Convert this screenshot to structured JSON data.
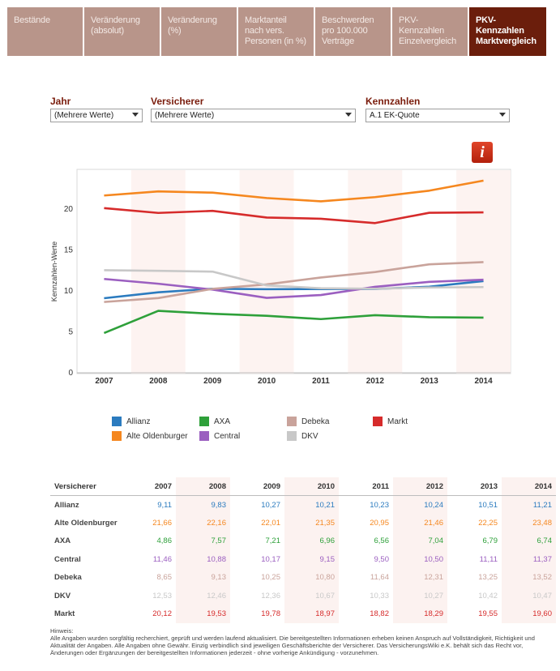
{
  "tabs": [
    {
      "label": "Bestände",
      "w": 93
    },
    {
      "label": "Veränderung (absolut)",
      "w": 93
    },
    {
      "label": "Veränderung (%)",
      "w": 93
    },
    {
      "label": "Marktanteil  nach vers. Personen (in %)",
      "w": 93
    },
    {
      "label": "Beschwerden pro 100.000 Verträge",
      "w": 93
    },
    {
      "label": "PKV-Kennzahlen Einzelvergleich",
      "w": 93
    },
    {
      "label": "PKV-Kennzahlen Marktvergleich",
      "w": 95,
      "active": true
    }
  ],
  "filters": {
    "year_label": "Jahr",
    "year_value": "(Mehrere Werte)",
    "insurer_label": "Versicherer",
    "insurer_value": "(Mehrere Werte)",
    "metric_label": "Kennzahlen",
    "metric_value": "A.1 EK-Quote"
  },
  "info_icon_glyph": "i",
  "chart_data": {
    "type": "line",
    "ylabel": "Kennzahlen-Werte",
    "xlabel": "",
    "categories": [
      "2007",
      "2008",
      "2009",
      "2010",
      "2011",
      "2012",
      "2013",
      "2014"
    ],
    "ylim": [
      0,
      25
    ],
    "yticks": [
      0,
      5,
      10,
      15,
      20
    ],
    "series": [
      {
        "name": "Allianz",
        "color": "#2b7bbf",
        "values": [
          9.11,
          9.83,
          10.27,
          10.21,
          10.23,
          10.24,
          10.51,
          11.21
        ]
      },
      {
        "name": "Alte Oldenburger",
        "color": "#f5871f",
        "values": [
          21.66,
          22.16,
          22.01,
          21.35,
          20.95,
          21.46,
          22.25,
          23.48
        ]
      },
      {
        "name": "AXA",
        "color": "#2ea03a",
        "values": [
          4.86,
          7.57,
          7.21,
          6.96,
          6.56,
          7.04,
          6.79,
          6.74
        ]
      },
      {
        "name": "Central",
        "color": "#9b5fc0",
        "values": [
          11.46,
          10.88,
          10.17,
          9.15,
          9.5,
          10.5,
          11.11,
          11.37
        ]
      },
      {
        "name": "Debeka",
        "color": "#c9a39b",
        "values": [
          8.65,
          9.13,
          10.25,
          10.8,
          11.64,
          12.31,
          13.25,
          13.52
        ]
      },
      {
        "name": "DKV",
        "color": "#c8c8c8",
        "values": [
          12.53,
          12.46,
          12.36,
          10.67,
          10.33,
          10.27,
          10.42,
          10.47
        ]
      },
      {
        "name": "Markt",
        "color": "#d62b2b",
        "values": [
          20.12,
          19.53,
          19.78,
          18.97,
          18.82,
          18.29,
          19.55,
          19.6
        ]
      }
    ]
  },
  "legend": [
    {
      "name": "Allianz",
      "color": "#2b7bbf"
    },
    {
      "name": "AXA",
      "color": "#2ea03a"
    },
    {
      "name": "Debeka",
      "color": "#c9a39b"
    },
    {
      "name": "Markt",
      "color": "#d62b2b"
    },
    {
      "name": "Alte Oldenburger",
      "color": "#f5871f"
    },
    {
      "name": "Central",
      "color": "#9b5fc0"
    },
    {
      "name": "DKV",
      "color": "#c8c8c8"
    }
  ],
  "table": {
    "header_name": "Versicherer",
    "years": [
      "2007",
      "2008",
      "2009",
      "2010",
      "2011",
      "2012",
      "2013",
      "2014"
    ],
    "rows": [
      {
        "name": "Allianz",
        "color": "#2b7bbf",
        "values": [
          "9,11",
          "9,83",
          "10,27",
          "10,21",
          "10,23",
          "10,24",
          "10,51",
          "11,21"
        ]
      },
      {
        "name": "Alte Oldenburger",
        "color": "#f5871f",
        "values": [
          "21,66",
          "22,16",
          "22,01",
          "21,35",
          "20,95",
          "21,46",
          "22,25",
          "23,48"
        ]
      },
      {
        "name": "AXA",
        "color": "#2ea03a",
        "values": [
          "4,86",
          "7,57",
          "7,21",
          "6,96",
          "6,56",
          "7,04",
          "6,79",
          "6,74"
        ]
      },
      {
        "name": "Central",
        "color": "#9b5fc0",
        "values": [
          "11,46",
          "10,88",
          "10,17",
          "9,15",
          "9,50",
          "10,50",
          "11,11",
          "11,37"
        ]
      },
      {
        "name": "Debeka",
        "color": "#c9a39b",
        "values": [
          "8,65",
          "9,13",
          "10,25",
          "10,80",
          "11,64",
          "12,31",
          "13,25",
          "13,52"
        ]
      },
      {
        "name": "DKV",
        "color": "#c8c8c8",
        "values": [
          "12,53",
          "12,46",
          "12,36",
          "10,67",
          "10,33",
          "10,27",
          "10,42",
          "10,47"
        ]
      },
      {
        "name": "Markt",
        "color": "#d62b2b",
        "values": [
          "20,12",
          "19,53",
          "19,78",
          "18,97",
          "18,82",
          "18,29",
          "19,55",
          "19,60"
        ]
      }
    ]
  },
  "note": {
    "heading": "Hinweis:",
    "text": "Alle Angaben wurden sorgfältig recherchiert, geprüft und werden laufend aktualisiert. Die bereitgestellten Informationen erheben keinen Anspruch auf Vollständigkeit, Richtigkeit und Aktualität der Angaben. Alle Angaben ohne Gewähr. Einzig verbindlich sind jeweiligen Geschäftsberichte der Versicherer. Das VersicherungsWiki e.K. behält sich das Recht vor, Änderungen oder Ergänzungen der bereitgestellten Informationen jederzeit - ohne vorherige Ankündigung - vorzunehmen."
  }
}
